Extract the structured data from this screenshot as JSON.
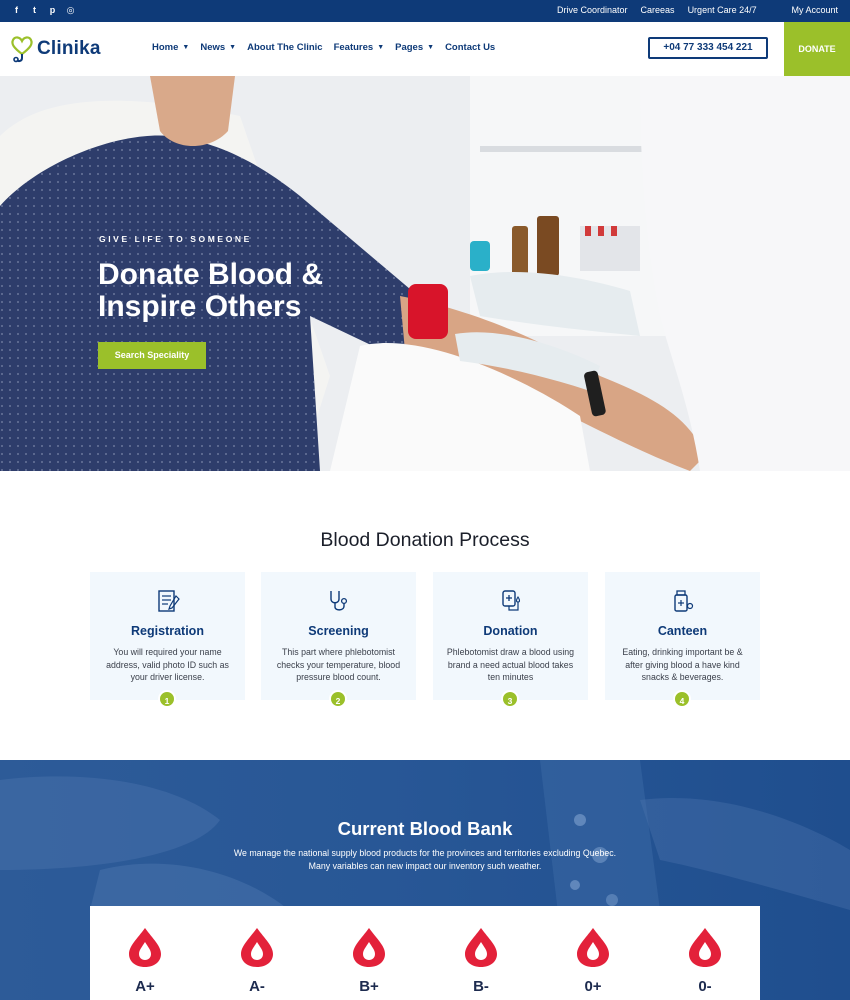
{
  "topbar": {
    "socials": [
      {
        "icon": "facebook-icon",
        "glyph": "f"
      },
      {
        "icon": "twitter-icon",
        "glyph": "t"
      },
      {
        "icon": "pinterest-icon",
        "glyph": "p"
      },
      {
        "icon": "instagram-icon",
        "glyph": "◎"
      }
    ],
    "links": [
      "Drive Coordinator",
      "Careeas",
      "Urgent Care 24/7"
    ],
    "account": "My Account"
  },
  "header": {
    "logo": "Clinika",
    "nav": [
      {
        "label": "Home",
        "dropdown": true
      },
      {
        "label": "News",
        "dropdown": true
      },
      {
        "label": "About The Clinic",
        "dropdown": false
      },
      {
        "label": "Features",
        "dropdown": true
      },
      {
        "label": "Pages",
        "dropdown": true
      },
      {
        "label": "Contact Us",
        "dropdown": false
      }
    ],
    "phone": "+04 77 333 454 221",
    "donate": "DONATE"
  },
  "hero": {
    "kicker": "GIVE LIFE TO SOMEONE",
    "title": "Donate Blood & Inspire Others",
    "cta": "Search Speciality"
  },
  "process": {
    "title": "Blood Donation Process",
    "steps": [
      {
        "title": "Registration",
        "desc": "You will required your name address, valid photo ID such as your driver license.",
        "num": "1",
        "icon": "clipboard-icon"
      },
      {
        "title": "Screening",
        "desc": "This part where phlebotomist checks your temperature, blood pressure blood count.",
        "num": "2",
        "icon": "stethoscope-icon"
      },
      {
        "title": "Donation",
        "desc": "Phlebotomist draw a blood using brand a need actual blood takes ten minutes",
        "num": "3",
        "icon": "blood-bag-icon"
      },
      {
        "title": "Canteen",
        "desc": "Eating, drinking important be & after giving blood a have kind snacks & beverages.",
        "num": "4",
        "icon": "medicine-bottle-icon"
      }
    ]
  },
  "bank": {
    "title": "Current Blood Bank",
    "desc": "We manage the national supply blood products for the provinces and territories excluding Quebec. Many variables can new impact our inventory such weather.",
    "groups": [
      "A+",
      "A-",
      "B+",
      "B-",
      "0+",
      "0-"
    ]
  },
  "colors": {
    "navy": "#0e3a78",
    "green": "#9bc02a",
    "red": "#e3213a",
    "card": "#f2f8fd"
  }
}
